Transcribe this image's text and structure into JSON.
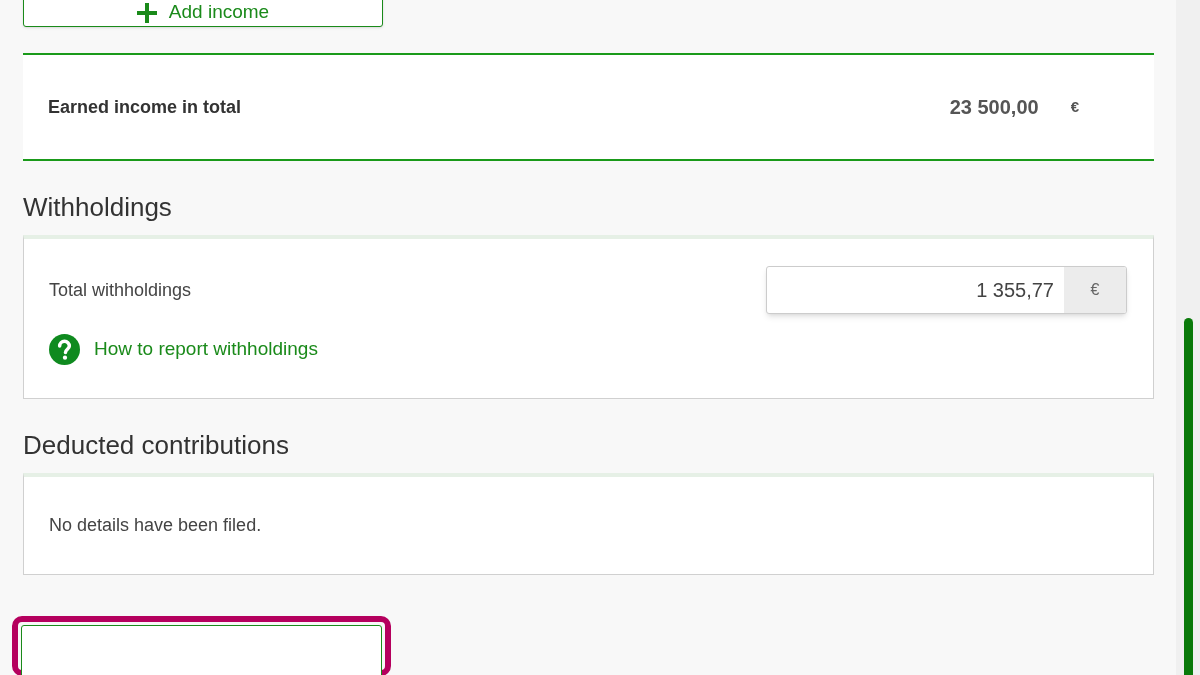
{
  "add_button": {
    "label": "Add income"
  },
  "earned_total": {
    "label": "Earned income in total",
    "amount": "23 500,00",
    "currency": "€"
  },
  "withholdings": {
    "heading": "Withholdings",
    "field_label": "Total withholdings",
    "value": "1 355,77",
    "currency": "€",
    "help_link": "How to report withholdings"
  },
  "deducted": {
    "heading": "Deducted contributions",
    "message": "No details have been filed."
  },
  "next_button": {
    "focused": true
  }
}
